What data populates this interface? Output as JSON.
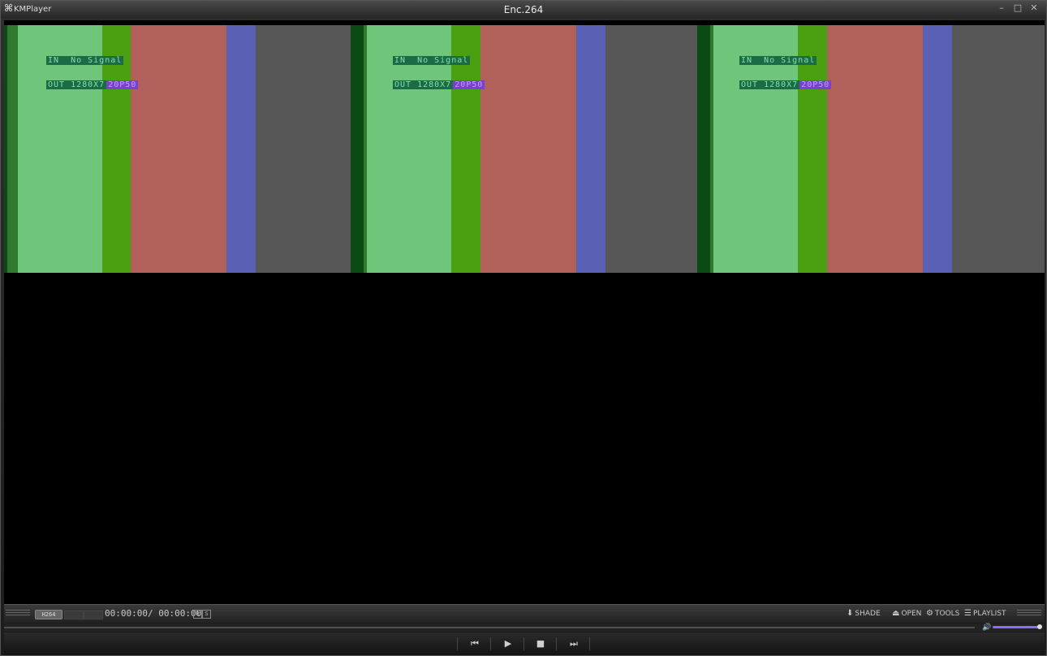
{
  "window": {
    "logo": "⌘",
    "app_name": "KMPlayer",
    "title": "Enc.264",
    "minimize": "–",
    "maximize": "□",
    "close": "✕"
  },
  "video": {
    "osd_line1_green": "IN  No Signal",
    "osd_line2_green": "OUT 1280X7",
    "osd_line2_purple": "20P50",
    "colors": {
      "light_green": "#6fc67a",
      "green": "#4aa010",
      "red": "#b1615a",
      "blue": "#5a60b4",
      "gray": "#575757",
      "dark_green": "#0c4a14"
    }
  },
  "status": {
    "codec": "H264",
    "time": "00:00:00/ 00:00:00",
    "mini_r": "R",
    "mini_s": "S",
    "shade_label": "SHADE",
    "open_label": "OPEN",
    "tools_label": "TOOLS",
    "playlist_label": "PLAYLIST",
    "volume_level": 1.0
  },
  "controls": {
    "prev": "⏮",
    "play": "▶",
    "stop": "■",
    "next": "⏭"
  }
}
